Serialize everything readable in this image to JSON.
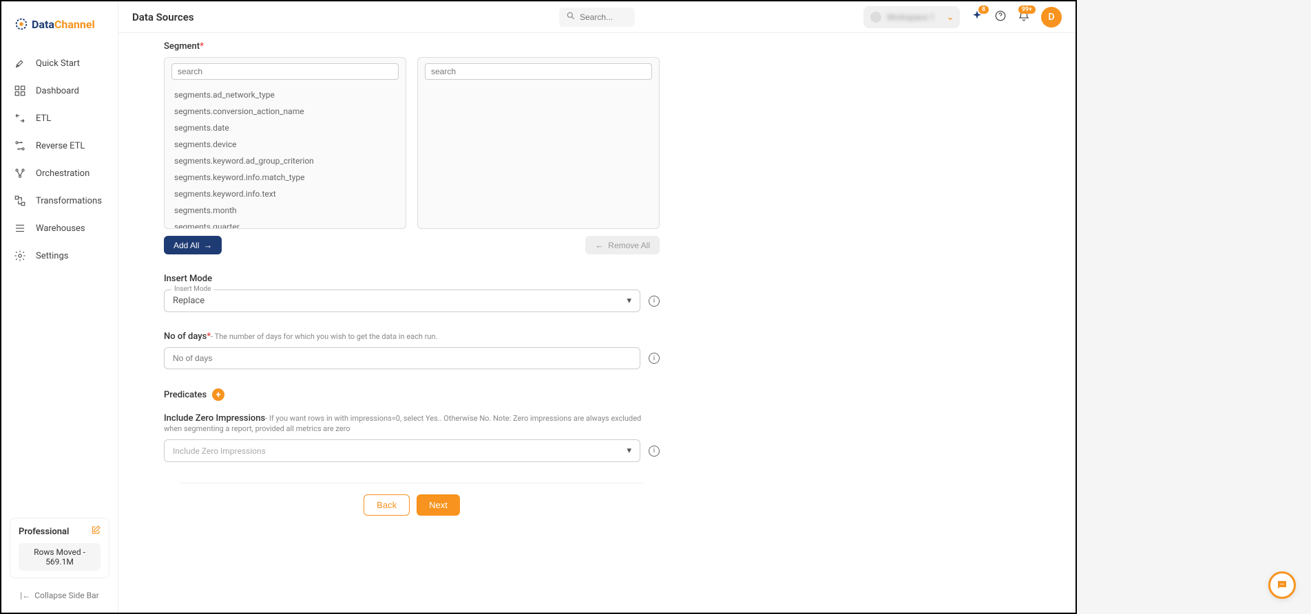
{
  "brand": {
    "name1": "Data",
    "name2": "Channel"
  },
  "sidebar": {
    "items": [
      {
        "label": "Quick Start"
      },
      {
        "label": "Dashboard"
      },
      {
        "label": "ETL"
      },
      {
        "label": "Reverse ETL"
      },
      {
        "label": "Orchestration"
      },
      {
        "label": "Transformations"
      },
      {
        "label": "Warehouses"
      },
      {
        "label": "Settings"
      }
    ],
    "plan": {
      "name": "Professional",
      "rows_moved": "Rows Moved - 569.1M"
    },
    "collapse_label": "Collapse Side Bar"
  },
  "topbar": {
    "page_title": "Data Sources",
    "search_placeholder": "Search...",
    "workspace_text": "Workspace 1",
    "sparkle_badge": "8",
    "bell_badge": "99+",
    "avatar_letter": "D"
  },
  "form": {
    "segment": {
      "label": "Segment",
      "search_placeholder": "search",
      "items": [
        "segments.ad_network_type",
        "segments.conversion_action_name",
        "segments.date",
        "segments.device",
        "segments.keyword.ad_group_criterion",
        "segments.keyword.info.match_type",
        "segments.keyword.info.text",
        "segments.month",
        "segments.quarter"
      ],
      "add_all": "Add All",
      "remove_all": "Remove All"
    },
    "insert_mode": {
      "label": "Insert Mode",
      "float_label": "Insert Mode",
      "value": "Replace"
    },
    "no_of_days": {
      "label": "No of days",
      "hint": "- The number of days for which you wish to get the data in each run.",
      "placeholder": "No of days"
    },
    "predicates": {
      "label": "Predicates"
    },
    "zero_impressions": {
      "label": "Include Zero Impressions",
      "hint": "- If you want rows in with impressions=0, select Yes.. Otherwise No. Note: Zero impressions are always excluded when segmenting a report, provided all metrics are zero",
      "placeholder": "Include Zero Impressions"
    },
    "footer": {
      "back": "Back",
      "next": "Next"
    }
  }
}
